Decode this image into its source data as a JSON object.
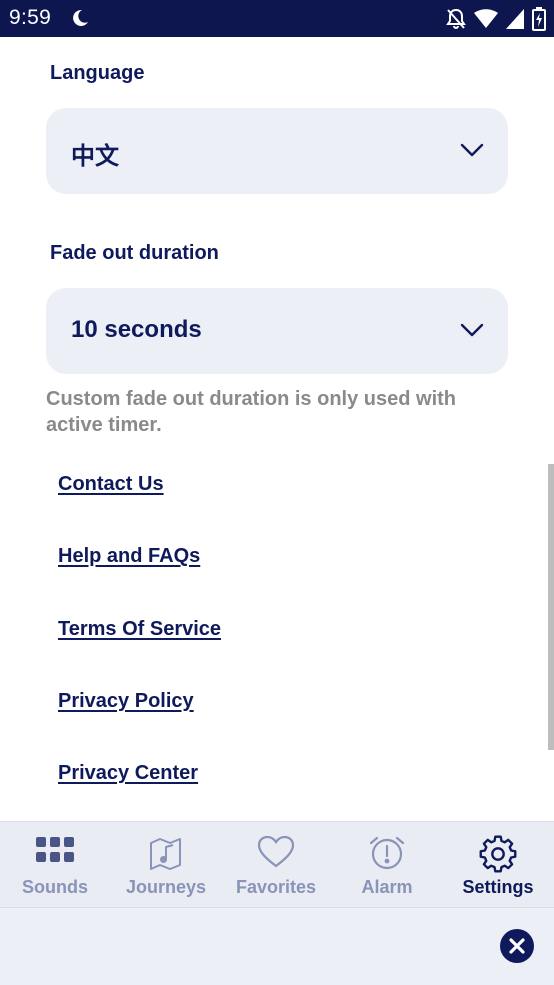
{
  "status_bar": {
    "time": "9:59",
    "icons": [
      "moon-icon",
      "notifications-off-icon",
      "wifi-icon",
      "signal-icon",
      "battery-icon"
    ]
  },
  "language": {
    "label": "Language",
    "value": "中文"
  },
  "fade_out": {
    "label": "Fade out duration",
    "value": "10 seconds",
    "note": "Custom fade out duration is only used with active timer."
  },
  "links": {
    "contact": "Contact Us",
    "help": "Help and FAQs",
    "terms": "Terms Of Service",
    "privacy_policy": "Privacy Policy",
    "privacy_center": "Privacy Center"
  },
  "nav": {
    "sounds": "Sounds",
    "journeys": "Journeys",
    "favorites": "Favorites",
    "alarm": "Alarm",
    "settings": "Settings",
    "active": "Settings"
  },
  "colors": {
    "primary": "#0e1a5b",
    "inactive_nav": "#8a93b8",
    "dropdown_bg": "#eceff5",
    "status_bar_bg": "#0d164f"
  }
}
